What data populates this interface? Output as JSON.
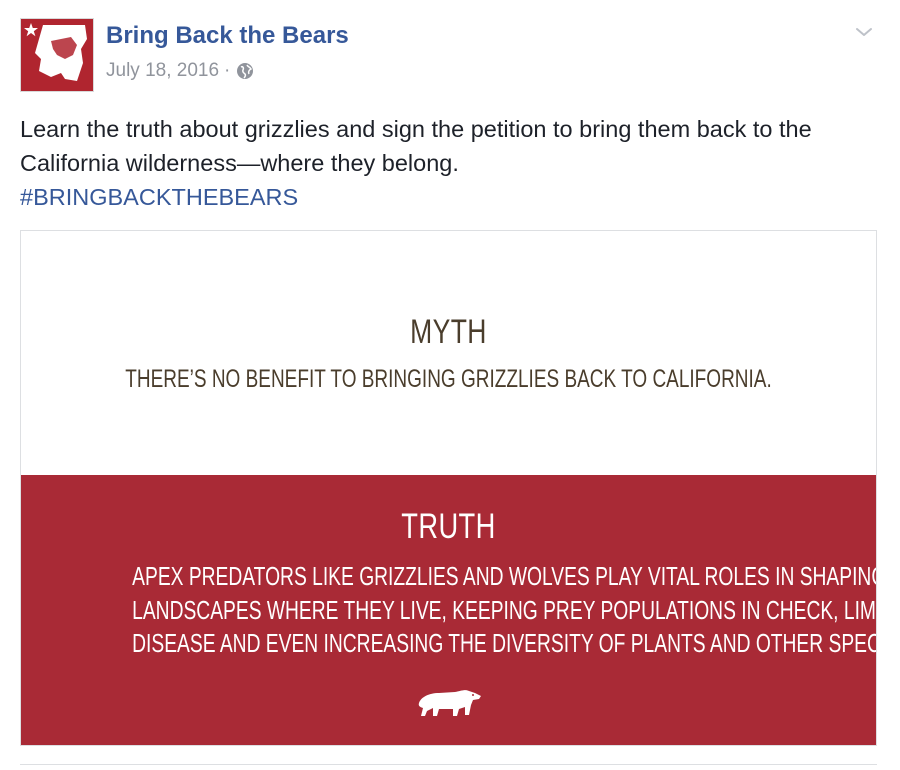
{
  "post": {
    "page_name": "Bring Back the Bears",
    "date": "July 18, 2016",
    "separator": "·",
    "privacy_icon": "globe-icon",
    "options_icon": "chevron-down-icon",
    "avatar_icon": "california-bear-flag-logo",
    "message": "Learn the truth about grizzlies and sign the petition to bring them back to the California wilderness—where they belong.",
    "hashtag": "#BRINGBACKTHEBEARS"
  },
  "image": {
    "myth_title": "MYTH",
    "myth_text": "THERE’S NO BENEFIT TO BRINGING GRIZZLIES BACK TO CALIFORNIA.",
    "truth_title": "TRUTH",
    "truth_lines": [
      "APEX PREDATORS LIKE GRIZZLIES AND WOLVES PLAY VITAL ROLES IN SHAPING THE",
      "LANDSCAPES WHERE THEY LIVE, KEEPING PREY POPULATIONS IN CHECK, LIMITING",
      "DISEASE AND EVEN INCREASING THE DIVERSITY OF PLANTS AND OTHER SPECIES."
    ],
    "footer_icon": "bear-icon"
  },
  "colors": {
    "link_blue": "#365899",
    "meta_gray": "#90949c",
    "text_dark": "#1d2129",
    "brand_red": "#a92a36",
    "myth_brown": "#4a3d2c"
  }
}
